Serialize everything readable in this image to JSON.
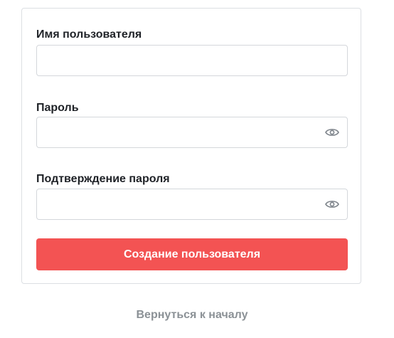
{
  "form": {
    "username": {
      "label": "Имя пользователя",
      "value": ""
    },
    "password": {
      "label": "Пароль",
      "value": "",
      "toggle_icon": "eye-icon"
    },
    "password_confirm": {
      "label": "Подтверждение пароля",
      "value": "",
      "toggle_icon": "eye-icon"
    },
    "submit_label": "Создание пользователя"
  },
  "back_link": "Вернуться к началу",
  "colors": {
    "submit_background": "#f35353",
    "submit_text": "#ffffff",
    "link": "#8b9196",
    "border": "#d4d7db"
  }
}
